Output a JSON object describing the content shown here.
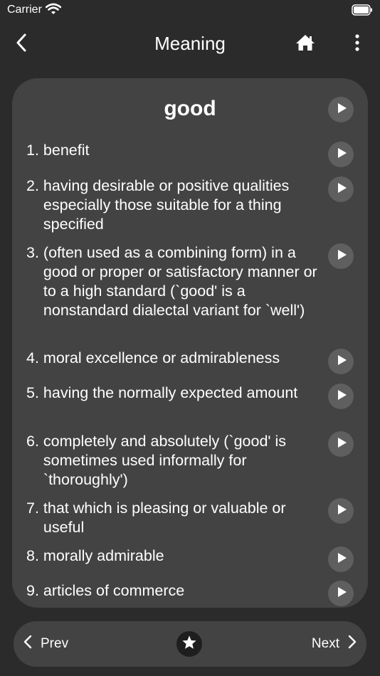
{
  "status_bar": {
    "carrier": "Carrier"
  },
  "nav": {
    "title": "Meaning"
  },
  "word": "good",
  "meanings": [
    {
      "num": "1. ",
      "text": "benefit"
    },
    {
      "num": "2. ",
      "text": "having desirable or positive qualities especially those suitable for a thing specified"
    },
    {
      "num": "3. ",
      "text": "(often used as a combining form) in a good or proper or satisfactory manner or to a high standard (`good' is a nonstandard dialectal variant for `well')"
    },
    {
      "num": "4. ",
      "text": "moral excellence or admirableness"
    },
    {
      "num": "5. ",
      "text": "having the normally expected amount"
    },
    {
      "num": "6. ",
      "text": "completely and absolutely (`good' is sometimes used informally for `thoroughly')"
    },
    {
      "num": "7. ",
      "text": "that which is pleasing or valuable or useful"
    },
    {
      "num": "8. ",
      "text": "morally admirable"
    },
    {
      "num": "9. ",
      "text": "articles of commerce"
    }
  ],
  "bottom_bar": {
    "prev_label": "Prev",
    "next_label": "Next"
  },
  "icons": {
    "back": "chevron-left-icon",
    "home": "home-icon",
    "more": "more-vertical-icon",
    "play": "play-icon",
    "favorite": "star-icon",
    "prev": "chevron-left-icon",
    "next": "chevron-right-icon"
  },
  "colors": {
    "background": "#2b2b2b",
    "card": "#434343",
    "play_button": "#5f5f5f",
    "favorite_button": "#1e1e1e",
    "text": "#ffffff"
  }
}
